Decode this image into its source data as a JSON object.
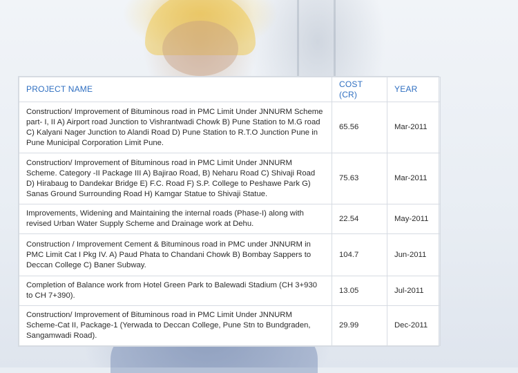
{
  "table": {
    "headers": [
      "PROJECT NAME",
      "COST (CR)",
      "YEAR"
    ],
    "rows": [
      {
        "project": "Construction/ Improvement of Bituminous road in PMC Limit Under JNNURM Scheme part- I, II A) Airport road Junction to Vishrantwadi Chowk B) Pune Station to M.G road C) Kalyani Nager Junction to Alandi Road D) Pune Station to R.T.O Junction Pune in Pune Municipal Corporation Limit Pune.",
        "cost": "65.56",
        "year": "Mar-2011"
      },
      {
        "project": "Construction/ Improvement of Bituminous road in PMC Limit Under JNNURM Scheme. Category -II Package III A) Bajirao Road, B) Neharu Road C) Shivaji Road D) Hirabaug to Dandekar Bridge E) F.C. Road F) S.P. College to Peshawe Park G) Sanas Ground Surrounding Road H) Kamgar Statue to Shivaji Statue.",
        "cost": "75.63",
        "year": "Mar-2011"
      },
      {
        "project": "Improvements, Widening and Maintaining the internal roads (Phase-I) along with revised Urban Water Supply Scheme and Drainage work at Dehu.",
        "cost": "22.54",
        "year": "May-2011"
      },
      {
        "project": "Construction / Improvement Cement & Bituminous road in PMC under JNNURM in PMC Limit Cat I Pkg IV. A) Paud Phata to Chandani Chowk B) Bombay Sappers to Deccan College C) Baner Subway.",
        "cost": "104.7",
        "year": "Jun-2011"
      },
      {
        "project": "Completion of Balance work from Hotel Green Park to Balewadi Stadium (CH 3+930 to CH 7+390).",
        "cost": "13.05",
        "year": "Jul-2011"
      },
      {
        "project": "Construction/ Improvement of Bituminous road in PMC Limit Under JNNURM Scheme-Cat II, Package-1 (Yerwada to Deccan College, Pune Stn to Bundgraden, Sangamwadi Road).",
        "cost": "29.99",
        "year": "Dec-2011"
      }
    ]
  }
}
